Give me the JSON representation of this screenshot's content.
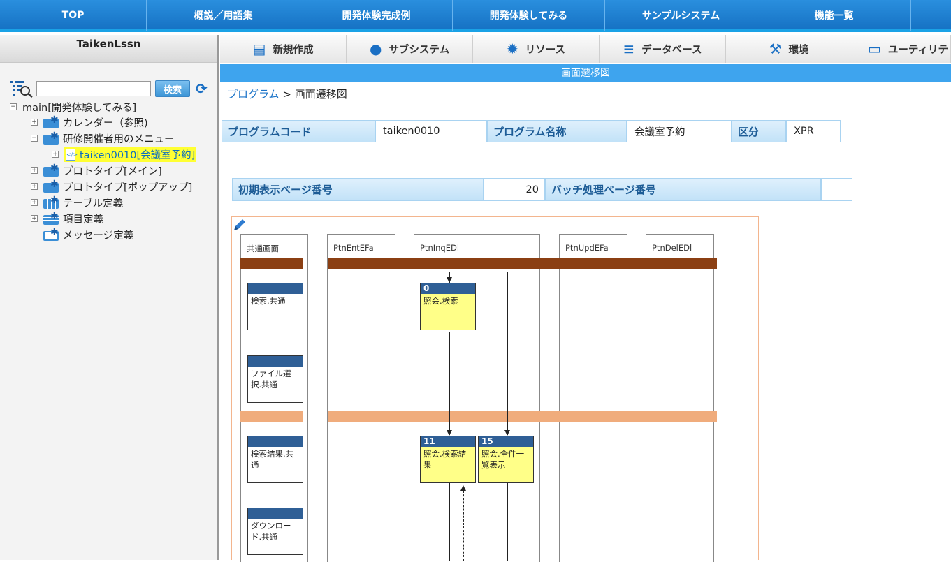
{
  "topnav": [
    "TOP",
    "概説／用語集",
    "開発体験完成例",
    "開発体験してみる",
    "サンプルシステム",
    "機能一覧"
  ],
  "sidebar": {
    "title": "TaikenLssn",
    "search_button": "検索",
    "tree": [
      {
        "label": "main[開発体験してみる]"
      },
      {
        "label": "カレンダー（参照)"
      },
      {
        "label": "研修開催者用のメニュー"
      },
      {
        "label": "taiken0010[会議室予約]"
      },
      {
        "label": "プロトタイプ[メイン]"
      },
      {
        "label": "プロトタイプ[ポップアップ]"
      },
      {
        "label": "テーブル定義"
      },
      {
        "label": "項目定義"
      },
      {
        "label": "メッセージ定義"
      }
    ]
  },
  "subnav": [
    {
      "label": "新規作成",
      "icon": "document-icon"
    },
    {
      "label": "サブシステム",
      "icon": "user-icon"
    },
    {
      "label": "リソース",
      "icon": "gear-icon"
    },
    {
      "label": "データベース",
      "icon": "database-icon"
    },
    {
      "label": "環境",
      "icon": "wrench-icon"
    },
    {
      "label": "ユーティリテ",
      "icon": "monitor-icon"
    }
  ],
  "page_header": "画面遷移図",
  "breadcrumb": {
    "link": "プログラム",
    "sep": ">",
    "current": "画面遷移図"
  },
  "info": {
    "code_label": "プログラムコード",
    "code_value": "taiken0010",
    "name_label": "プログラム名称",
    "name_value": "会議室予約",
    "kubun_label": "区分",
    "kubun_value": "XPR",
    "init_page_label": "初期表示ページ番号",
    "init_page_value": "20",
    "batch_page_label": "バッチ処理ページ番号",
    "batch_page_value": ""
  },
  "diagram": {
    "lanes": [
      "共通画面",
      "PtnEntEFa",
      "PtnInqEDl",
      "PtnUpdEFa",
      "PtnDelEDl"
    ],
    "common_cards": [
      "検索.共通",
      "ファイル選択.共通",
      "検索結果.共通",
      "ダウンロード.共通"
    ],
    "cards": [
      {
        "num": "0",
        "label": "照会.検索"
      },
      {
        "num": "11",
        "label": "照会.検索結果"
      },
      {
        "num": "15",
        "label": "照会.全件一覧表示"
      }
    ],
    "colors": {
      "dark_bar": "#8b3f13",
      "light_bar": "#f0ac7c",
      "card_header": "#2f5f96",
      "card_fill": "#ffff88"
    }
  }
}
